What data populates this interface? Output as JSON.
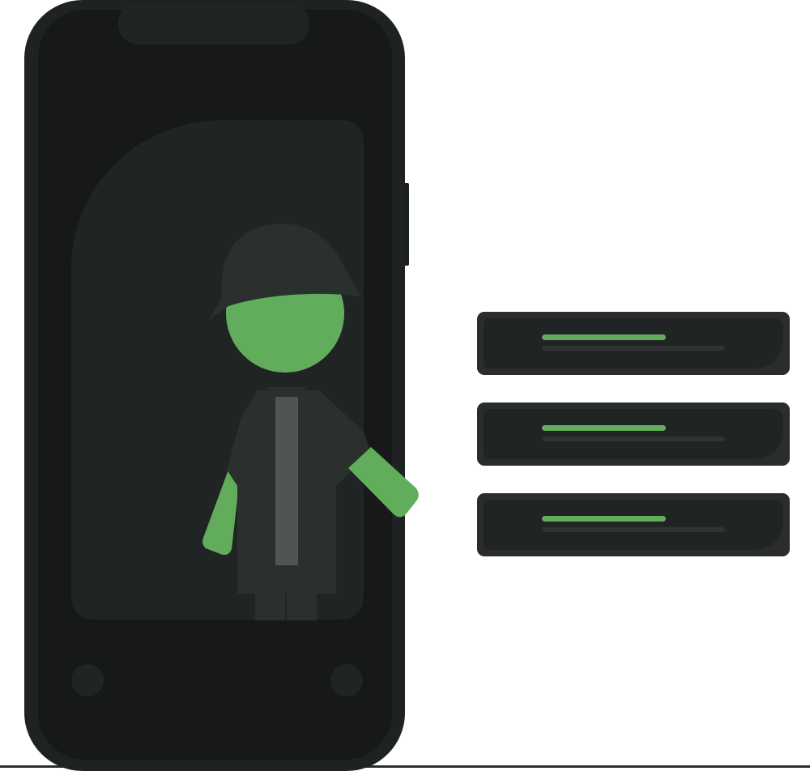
{
  "colors": {
    "background": "#ffffff",
    "phone_body": "#1f2222",
    "phone_screen": "#171918",
    "phone_inner_card": "#202424",
    "side_button": "#1c1f1f",
    "figure_hat": "#2a312d",
    "figure_skin": "#61ad5b",
    "figure_jacket": "#2a312d",
    "figure_shirt": "#505552",
    "card_outer": "#2b2d2d",
    "card_inner": "#202424",
    "card_line_primary": "#61ad5b",
    "card_line_secondary": "#2f3433",
    "ground_line": "#2b2d2d"
  },
  "cards": [
    {
      "name": "list-card-1"
    },
    {
      "name": "list-card-2"
    },
    {
      "name": "list-card-3"
    }
  ]
}
